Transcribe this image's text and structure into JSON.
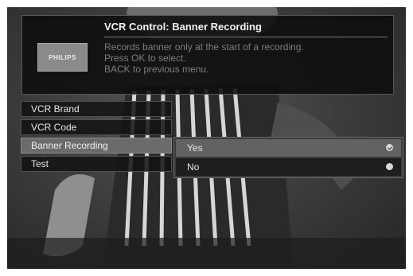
{
  "info": {
    "brand_logo": "PHILIPS",
    "title": "VCR Control: Banner Recording",
    "description": [
      "Records banner only at the start of a recording.",
      "Press OK to select.",
      "BACK to previous menu."
    ]
  },
  "menu": {
    "items": [
      {
        "label": "VCR Brand",
        "selected": false
      },
      {
        "label": "VCR Code",
        "selected": false
      },
      {
        "label": "Banner Recording",
        "selected": true
      },
      {
        "label": "Test",
        "selected": false
      }
    ]
  },
  "submenu": {
    "options": [
      {
        "label": "Yes",
        "checked": true
      },
      {
        "label": "No",
        "checked": false
      }
    ]
  },
  "colors": {
    "panel_bg": "#0c0c0c",
    "selected_bg": "#6b6b6b",
    "muted_text": "#7d7d7d"
  }
}
